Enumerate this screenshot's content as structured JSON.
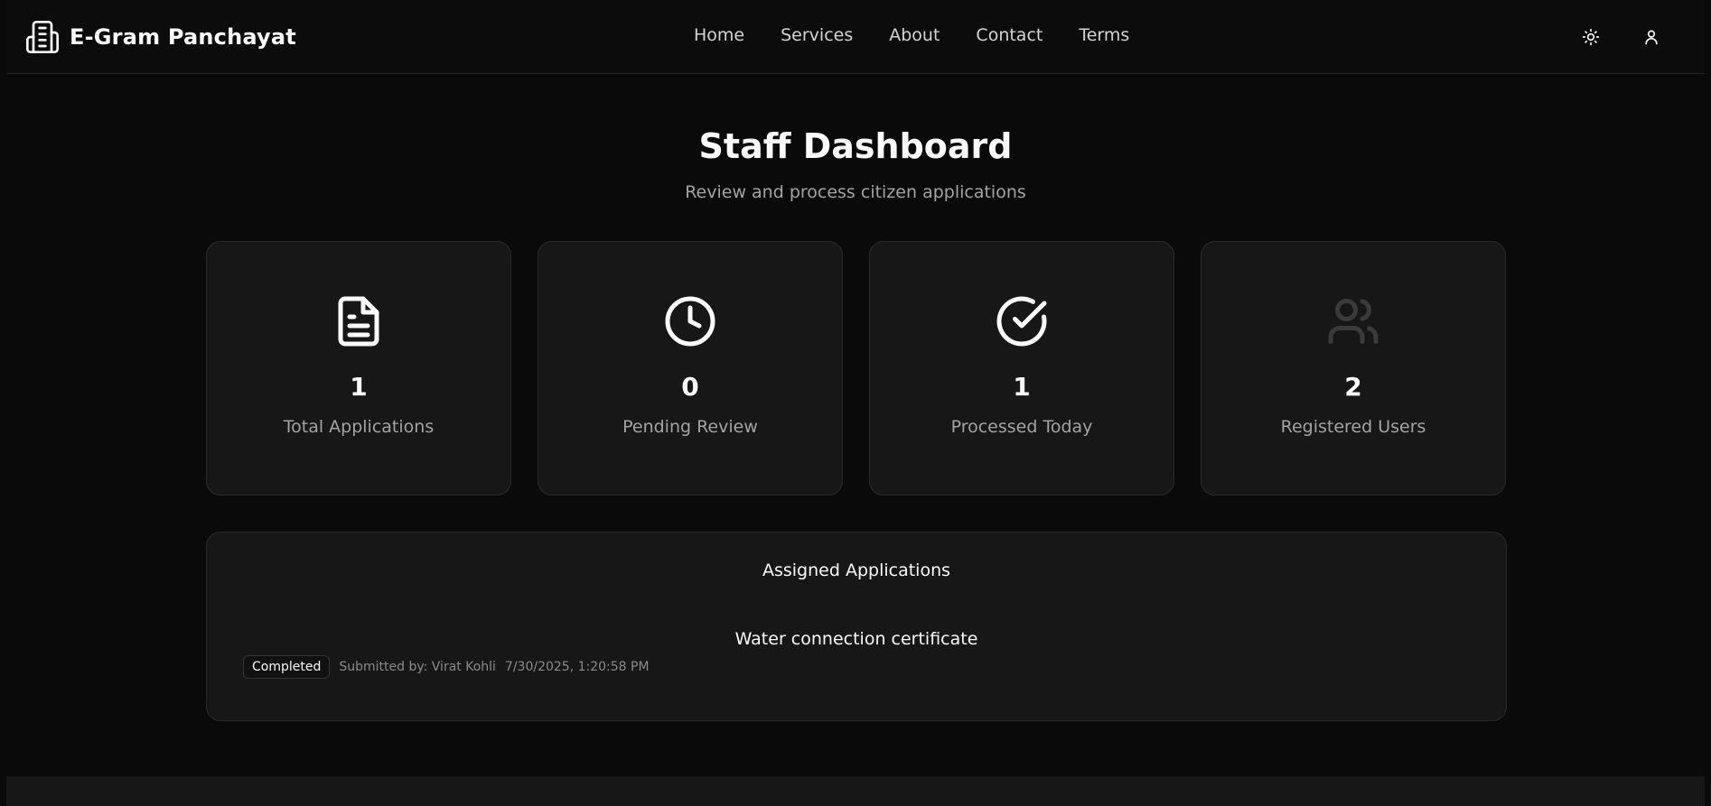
{
  "brand": {
    "name": "E-Gram Panchayat",
    "icon": "building-icon"
  },
  "nav": {
    "links": [
      "Home",
      "Services",
      "About",
      "Contact",
      "Terms"
    ],
    "theme_icon": "sun-icon",
    "user_icon": "user-icon"
  },
  "hero": {
    "title": "Staff Dashboard",
    "subtitle": "Review and process citizen applications"
  },
  "stats": [
    {
      "icon": "document-icon",
      "value": "1",
      "label": "Total Applications"
    },
    {
      "icon": "clock-icon",
      "value": "0",
      "label": "Pending Review"
    },
    {
      "icon": "check-circle-icon",
      "value": "1",
      "label": "Processed Today"
    },
    {
      "icon": "users-icon",
      "value": "2",
      "label": "Registered Users"
    }
  ],
  "applications": {
    "title": "Assigned Applications",
    "items": [
      {
        "name": "Water connection certificate",
        "status": "Completed",
        "submitted_by": "Submitted by: Virat Kohli",
        "timestamp": "7/30/2025, 1:20:58 PM"
      }
    ]
  },
  "colors": {
    "background": "#0a0a0a",
    "card": "#171717",
    "border": "#2a2a2a",
    "text": "#fafafa",
    "muted": "#a3a3a3"
  }
}
